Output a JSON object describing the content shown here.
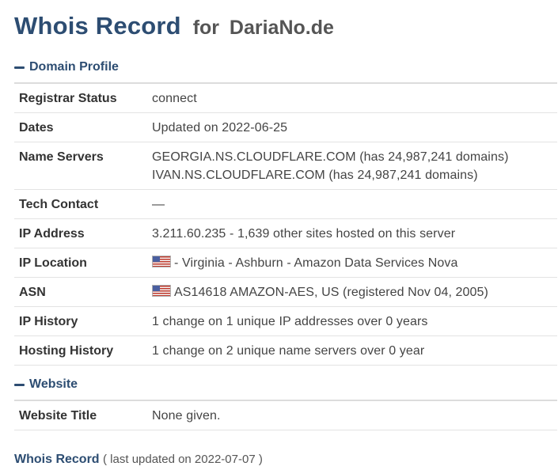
{
  "header": {
    "title": "Whois Record",
    "for_text": "for",
    "domain": "DariaNo.de"
  },
  "domain_profile": {
    "heading": "Domain Profile",
    "rows": {
      "registrar_status": {
        "label": "Registrar Status",
        "value": "connect"
      },
      "dates": {
        "label": "Dates",
        "value": "Updated on 2022-06-25"
      },
      "name_servers": {
        "label": "Name Servers",
        "values": [
          "GEORGIA.NS.CLOUDFLARE.COM (has 24,987,241 domains)",
          "IVAN.NS.CLOUDFLARE.COM (has 24,987,241 domains)"
        ]
      },
      "tech_contact": {
        "label": "Tech Contact",
        "value": "—"
      },
      "ip_address": {
        "label": "IP Address",
        "value": "3.211.60.235 - 1,639 other sites hosted on this server"
      },
      "ip_location": {
        "label": "IP Location",
        "value": "- Virginia - Ashburn - Amazon Data Services Nova"
      },
      "asn": {
        "label": "ASN",
        "value": "AS14618 AMAZON-AES, US (registered Nov 04, 2005)"
      },
      "ip_history": {
        "label": "IP History",
        "value": "1 change on 1 unique IP addresses over 0 years"
      },
      "hosting_history": {
        "label": "Hosting History",
        "value": "1 change on 2 unique name servers over 0 year"
      }
    }
  },
  "website": {
    "heading": "Website",
    "rows": {
      "website_title": {
        "label": "Website Title",
        "value": "None given."
      }
    }
  },
  "footer": {
    "title": "Whois Record",
    "note": "( last updated on 2022-07-07 )"
  },
  "icons": {
    "section_toggle": "minus-icon",
    "country_flag": "us-flag-icon"
  },
  "colors": {
    "heading_blue": "#2d4d72",
    "text": "#333333"
  }
}
